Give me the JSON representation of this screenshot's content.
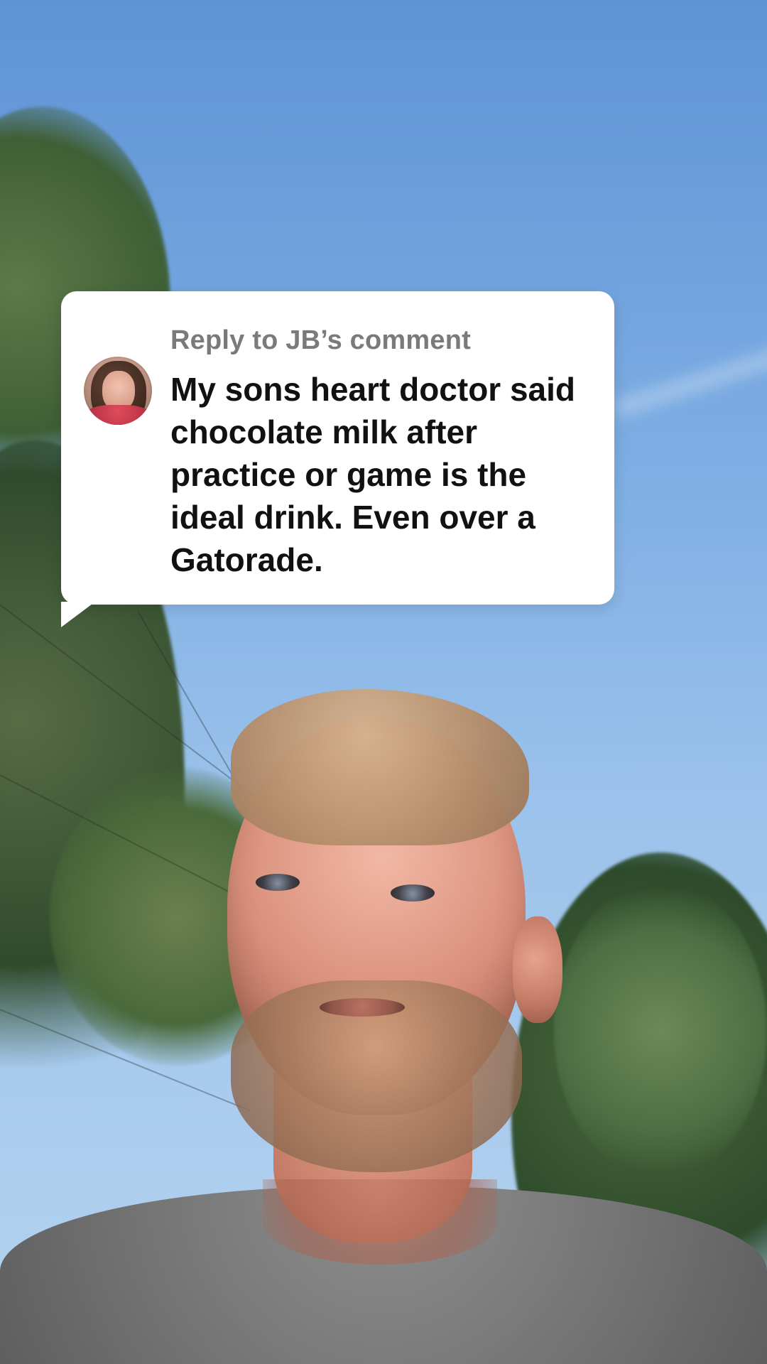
{
  "reply_label": "Reply to JB’s comment",
  "comment_text": "My sons heart doctor said chocolate milk after practice or game is the ideal drink. Even over a Gatorade.",
  "avatar_icon": "commenter-avatar"
}
